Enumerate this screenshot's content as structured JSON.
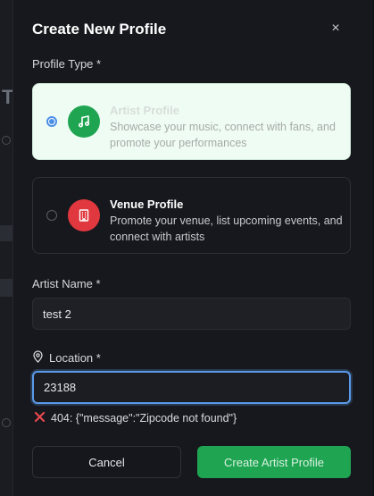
{
  "modal": {
    "title": "Create New Profile",
    "profile_type_label": "Profile Type *",
    "options": [
      {
        "title": "Artist Profile",
        "description": "Showcase your music, connect with fans, and promote your performances",
        "selected": true,
        "icon": "music-note-icon"
      },
      {
        "title": "Venue Profile",
        "description": "Promote your venue, list upcoming events, and connect with artists",
        "selected": false,
        "icon": "building-icon"
      }
    ],
    "artist_name_label": "Artist Name *",
    "artist_name_value": "test 2",
    "location_label": "Location *",
    "location_value": "23188",
    "error_text": "404: {\"message\":\"Zipcode not found\"}",
    "cancel_label": "Cancel",
    "create_label": "Create Artist Profile"
  },
  "colors": {
    "accent_green": "#1fa552",
    "venue_red": "#e0383e",
    "focus_blue": "#5a9ae8",
    "error_red": "#e5484d"
  }
}
